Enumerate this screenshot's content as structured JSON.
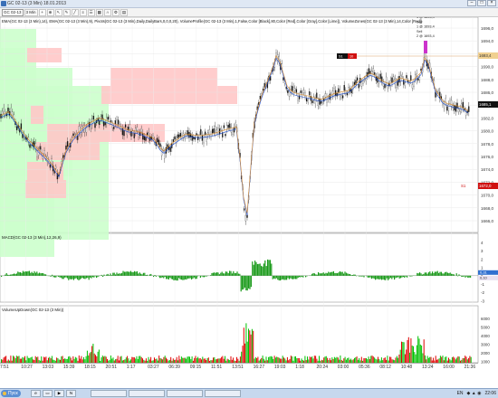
{
  "window": {
    "title": "GC 02-13 (3 Min)  18.01.2013"
  },
  "toolbar": {
    "instrument": "GC 02-13",
    "interval": "3 Min",
    "buttons": [
      "crosshair",
      "zoom",
      "pointer",
      "pencil",
      "draw",
      "lines",
      "fib",
      "grid",
      "magnet",
      "properties",
      "data"
    ]
  },
  "panes": {
    "price": {
      "indicator_line": "EMA(GC 02-13 (3 Min),14), EMA(GC 02-13 (3 Min),9), Pivots(GC 02-13 (3 Min),Daily,DailyBars,0,0,0,20), VolumeProfile(GC 02-13 (3 Min),1,False,Color [Black],80,Color [Red],Color [Gray],Color [Lime]), VolumeZones(GC 02-13 (3 Min),14,Color [Red])",
      "labels": [
        "1696,0",
        "1694,0",
        "1692,0",
        "1690,0",
        "1688,0",
        "1686,0",
        "1684,0",
        "1682,0",
        "1680,0",
        "1678,0",
        "1676,0",
        "1674,0",
        "1672,0",
        "1670,0",
        "1668,0",
        "1666,0"
      ],
      "current_price": "1685,1",
      "r1_price": "1693,4",
      "s1_label": "S1",
      "s1_price": "1672,0",
      "order_tag": "S1",
      "trade_labels": [
        "1 @ 1693,4",
        "Sell",
        "1 @ 1693,4",
        "Sell",
        "2 @ 1693,4"
      ]
    },
    "macd": {
      "title": "MACD(GC 02-13 (3 Min),12,26,9)",
      "labels": [
        "4",
        "3",
        "2",
        "1",
        "0",
        "-1",
        "-2",
        "-3"
      ],
      "value1": "0,31",
      "value2": "0,10"
    },
    "volume": {
      "title": "VolumeUpDown(GC 02-13 (3 Min))",
      "labels": [
        "6000",
        "5000",
        "4000",
        "3000",
        "2000",
        "1000"
      ]
    }
  },
  "xaxis": [
    "7:51",
    "10:27",
    "13:03",
    "15:39",
    "18:15",
    "20:51",
    "1:17",
    "03:27",
    "06:39",
    "09:15",
    "11:51",
    "13:51",
    "16:27",
    "19:03",
    "1:18",
    "20:24",
    "03:00",
    "05:36",
    "08:12",
    "10:48",
    "13:24",
    "16:00",
    "21:36"
  ],
  "taskbar": {
    "start": "Пуск",
    "lang": "EN",
    "clock": "22:06",
    "items": [
      "ie",
      "explorer",
      "media",
      "ninja",
      "task1",
      "task2",
      "task3",
      "task4"
    ]
  },
  "colors": {
    "up": "#00c000",
    "down": "#e00000",
    "macd_hist": "#1a9a1a",
    "zone_green": "#ccffcc",
    "zone_red": "#ffc8c8"
  }
}
